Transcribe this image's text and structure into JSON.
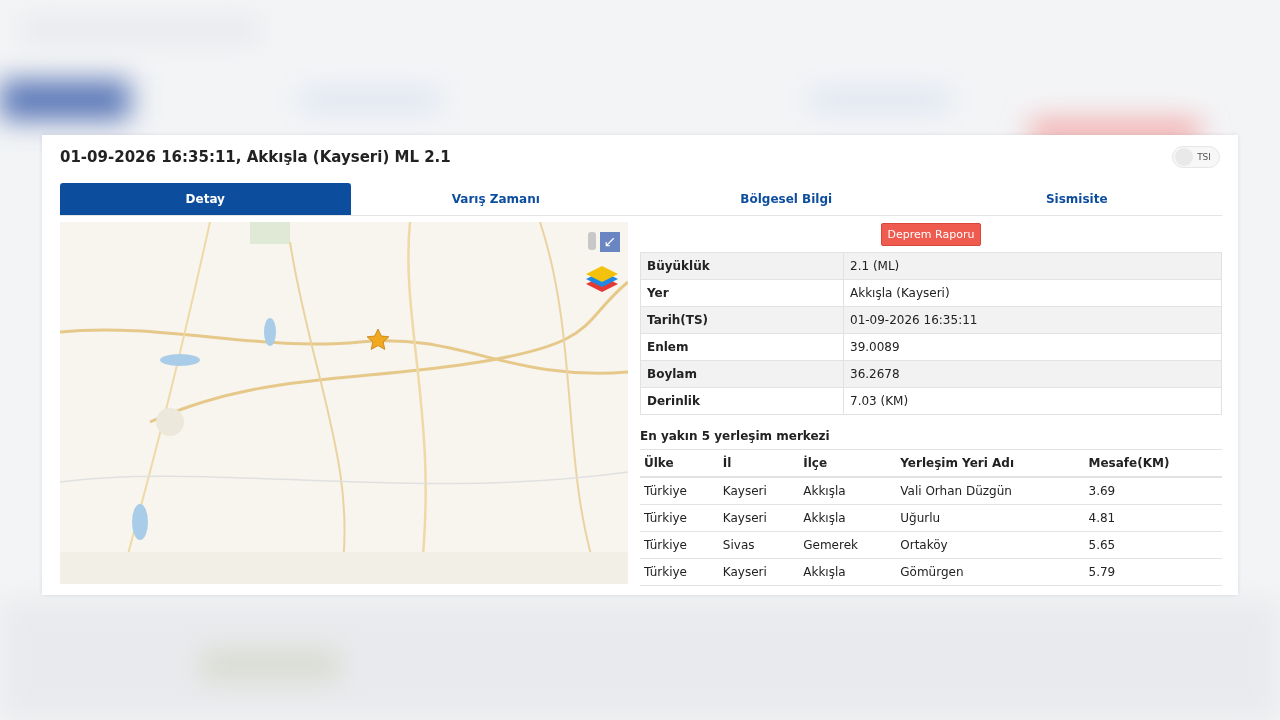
{
  "dialog": {
    "title": "01-09-2026 16:35:11, Akkışla (Kayseri) ML 2.1",
    "time_toggle": {
      "label": "TSI",
      "on": false
    }
  },
  "tabs": [
    {
      "label": "Detay",
      "selected": true
    },
    {
      "label": "Varış Zamanı",
      "selected": false
    },
    {
      "label": "Bölgesel Bilgi",
      "selected": false
    },
    {
      "label": "Sismisite",
      "selected": false
    }
  ],
  "report_button": "Deprem Raporu",
  "details": [
    {
      "label": "Büyüklük",
      "value": "2.1 (ML)"
    },
    {
      "label": "Yer",
      "value": "Akkışla (Kayseri)"
    },
    {
      "label": "Tarih(TS)",
      "value": "01-09-2026 16:35:11"
    },
    {
      "label": "Enlem",
      "value": "39.0089"
    },
    {
      "label": "Boylam",
      "value": "36.2678"
    },
    {
      "label": "Derinlik",
      "value": "7.03 (KM)"
    }
  ],
  "settlements": {
    "title": "En yakın 5 yerleşim merkezi",
    "columns": [
      "Ülke",
      "İl",
      "İlçe",
      "Yerleşim Yeri Adı",
      "Mesafe(KM)"
    ],
    "rows": [
      [
        "Türkiye",
        "Kayseri",
        "Akkışla",
        "Vali Orhan Düzgün",
        "3.69"
      ],
      [
        "Türkiye",
        "Kayseri",
        "Akkışla",
        "Uğurlu",
        "4.81"
      ],
      [
        "Türkiye",
        "Sivas",
        "Gemerek",
        "Ortaköy",
        "5.65"
      ],
      [
        "Türkiye",
        "Kayseri",
        "Akkışla",
        "Gömürgen",
        "5.79"
      ]
    ]
  }
}
